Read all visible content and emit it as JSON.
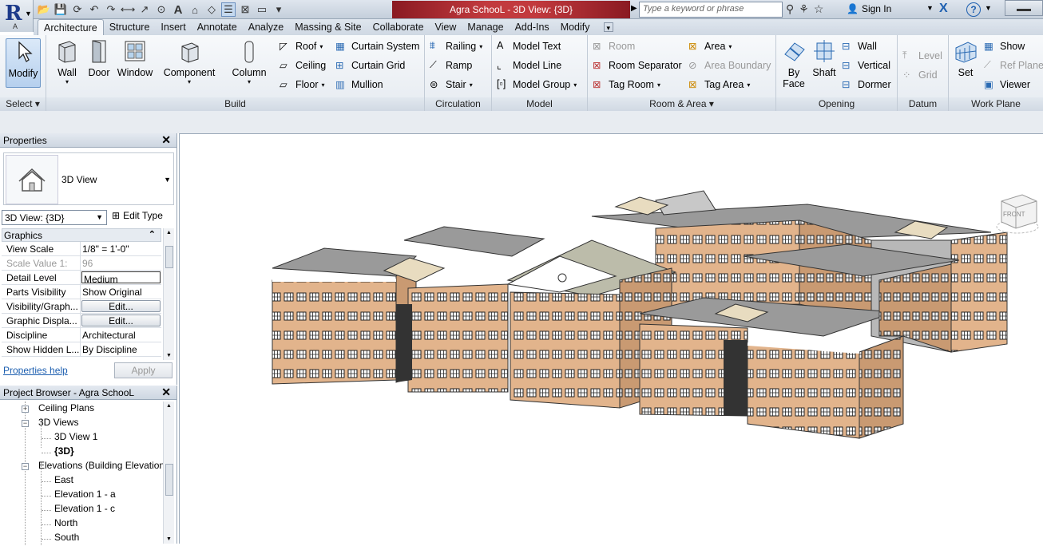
{
  "app": {
    "letter": "A"
  },
  "titlebar": {
    "document_title": "Agra SchooL - 3D View: {3D}",
    "search_placeholder": "Type a keyword or phrase",
    "sign_in": "Sign In"
  },
  "tabs": [
    "Architecture",
    "Structure",
    "Insert",
    "Annotate",
    "Analyze",
    "Massing & Site",
    "Collaborate",
    "View",
    "Manage",
    "Add-Ins",
    "Modify"
  ],
  "ribbon": {
    "select": {
      "modify": "Modify",
      "label": "Select"
    },
    "build": {
      "label": "Build",
      "wall": "Wall",
      "door": "Door",
      "window": "Window",
      "component": "Component",
      "column": "Column",
      "roof": "Roof",
      "ceiling": "Ceiling",
      "floor": "Floor",
      "curtain_system": "Curtain System",
      "curtain_grid": "Curtain Grid",
      "mullion": "Mullion"
    },
    "circulation": {
      "label": "Circulation",
      "railing": "Railing",
      "ramp": "Ramp",
      "stair": "Stair"
    },
    "model": {
      "label": "Model",
      "model_text": "Model Text",
      "model_line": "Model Line",
      "model_group": "Model Group"
    },
    "room_area": {
      "label": "Room & Area",
      "room": "Room",
      "room_separator": "Room Separator",
      "tag_room": "Tag Room",
      "area": "Area",
      "area_boundary": "Area Boundary",
      "tag_area": "Tag Area"
    },
    "opening": {
      "label": "Opening",
      "by_face_1": "By",
      "by_face_2": "Face",
      "shaft": "Shaft",
      "wall": "Wall",
      "vertical": "Vertical",
      "dormer": "Dormer"
    },
    "datum": {
      "label": "Datum",
      "level": "Level",
      "grid": "Grid"
    },
    "work_plane": {
      "label": "Work Plane",
      "set": "Set",
      "show": "Show",
      "ref_plane": "Ref Plane",
      "viewer": "Viewer"
    }
  },
  "properties": {
    "title": "Properties",
    "type_name": "3D View",
    "view_selector": "3D View: {3D}",
    "edit_type": "Edit Type",
    "group": "Graphics",
    "rows": [
      {
        "k": "View Scale",
        "v": "1/8\" = 1'-0\""
      },
      {
        "k": "Scale Value   1:",
        "v": "96"
      },
      {
        "k": "Detail Level",
        "v": "Medium"
      },
      {
        "k": "Parts Visibility",
        "v": "Show Original"
      },
      {
        "k": "Visibility/Graph...",
        "v": "Edit..."
      },
      {
        "k": "Graphic Displa...",
        "v": "Edit..."
      },
      {
        "k": "Discipline",
        "v": "Architectural"
      },
      {
        "k": "Show Hidden L...",
        "v": "By Discipline"
      }
    ],
    "help": "Properties help",
    "apply": "Apply"
  },
  "browser": {
    "title": "Project Browser - Agra SchooL",
    "nodes": [
      "Ceiling Plans",
      "3D Views",
      "3D View 1",
      "{3D}",
      "Elevations (Building Elevation",
      "East",
      "Elevation 1 - a",
      "Elevation 1 - c",
      "North",
      "South"
    ]
  },
  "viewcube": {
    "face": "FRONT"
  }
}
